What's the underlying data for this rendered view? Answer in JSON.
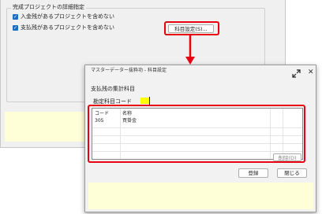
{
  "background_window": {
    "group_title": "完成プロジェクトの詳細指定",
    "checkbox_1_label": "入金残があるプロジェクトを含めない",
    "checkbox_2_label": "支払残があるプロジェクトを含めない",
    "account_settings_button": "科目設定(S)..."
  },
  "dialog": {
    "title": "マスターデーター抜粋功 - 科目設定",
    "section_label": "支払残の集計科目",
    "code_field_label": "勘定科目コード",
    "grid": {
      "columns": [
        "コード",
        "名称"
      ],
      "rows": [
        [
          "305",
          "買掛金"
        ]
      ]
    },
    "delete_button": "削除(D)",
    "ok_button": "登録",
    "close_button": "閉じる"
  },
  "colors": {
    "highlight_red": "#e60012",
    "checkbox_blue": "#1b6ec2",
    "input_yellow": "#ffff00",
    "info_panel_yellow": "#fefed7"
  }
}
